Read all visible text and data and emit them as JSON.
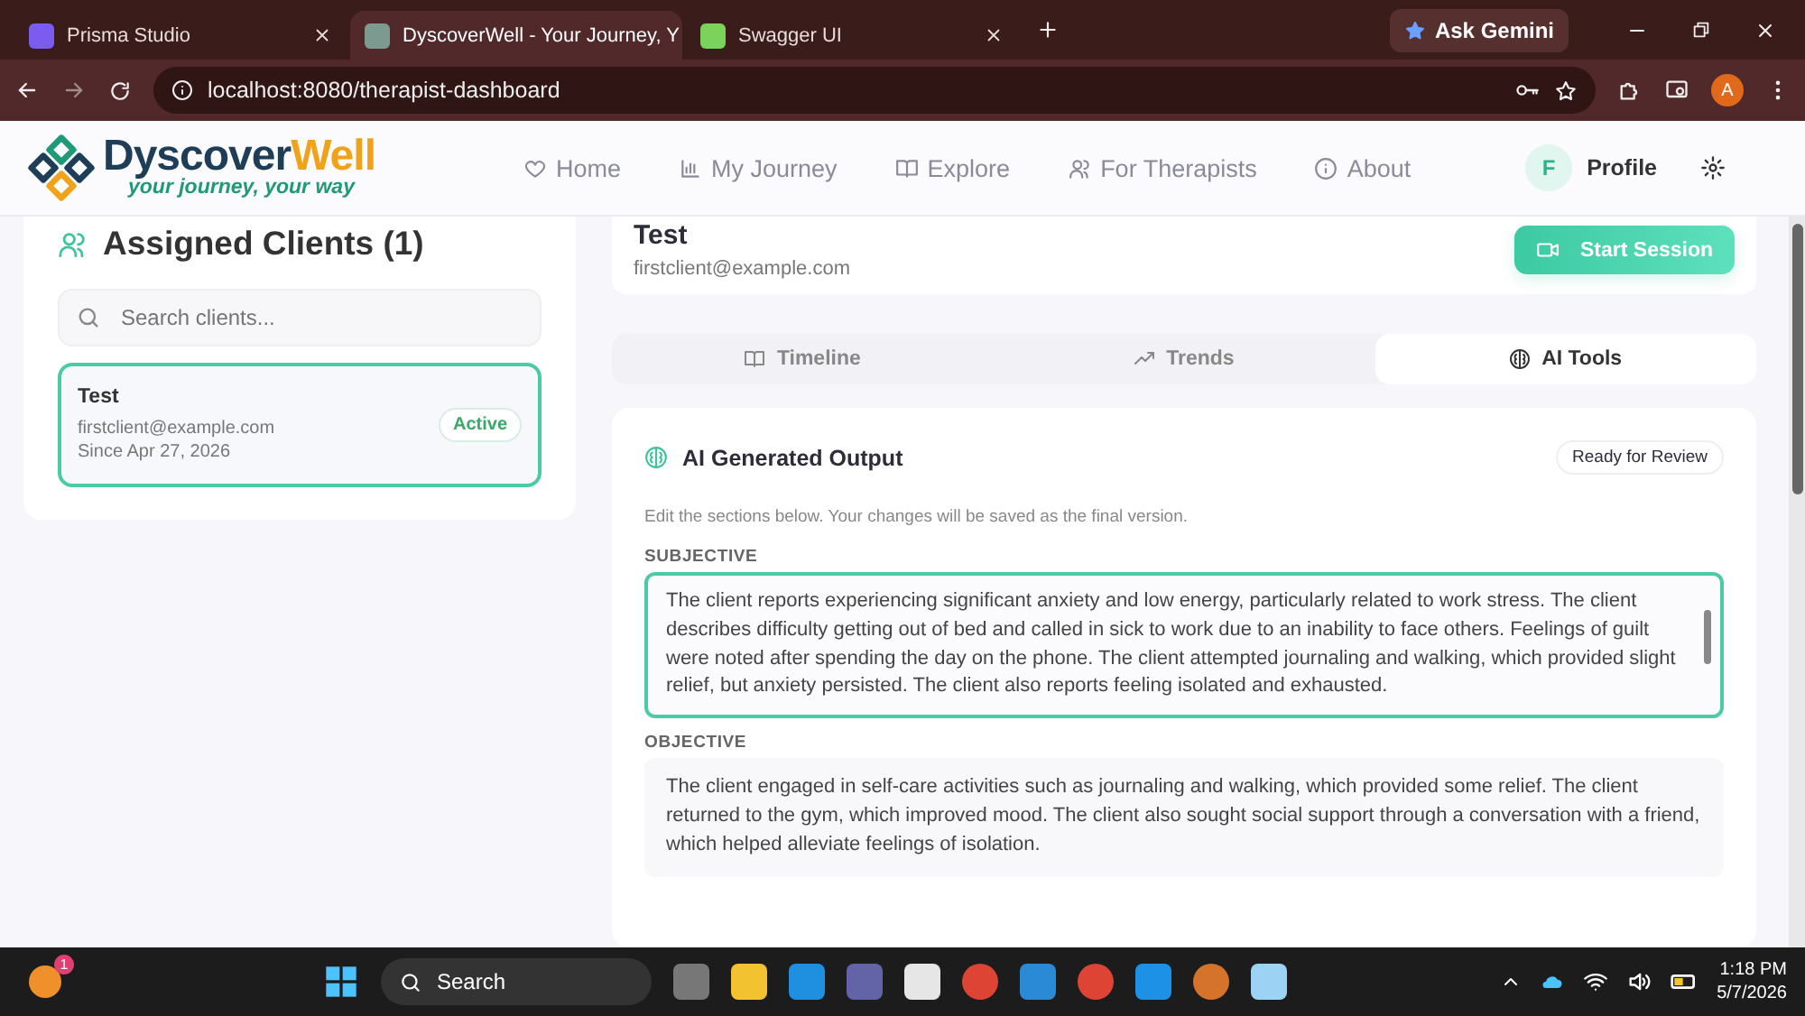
{
  "browser": {
    "tabs": [
      {
        "title": "Prisma Studio",
        "selected": false
      },
      {
        "title": "DyscoverWell - Your Journey, Y",
        "selected": true
      },
      {
        "title": "Swagger UI",
        "selected": false
      }
    ],
    "gemini": "Ask Gemini",
    "url": "localhost:8080/therapist-dashboard",
    "avatar": "A"
  },
  "header": {
    "logo": "Dyscover",
    "logo_accent": "Well",
    "tagline": "your journey, your way",
    "nav": [
      {
        "label": "Home"
      },
      {
        "label": "My Journey"
      },
      {
        "label": "Explore"
      },
      {
        "label": "For Therapists"
      },
      {
        "label": "About"
      }
    ],
    "profile_initial": "F",
    "profile": "Profile"
  },
  "clients": {
    "title": "Assigned Clients (1)",
    "search_placeholder": "Search clients...",
    "items": [
      {
        "name": "Test",
        "email": "firstclient@example.com",
        "since": "Since Apr 27, 2026",
        "status": "Active",
        "selected": true
      }
    ]
  },
  "client": {
    "name": "Test",
    "email": "firstclient@example.com",
    "start": "Start Session"
  },
  "tabs": [
    {
      "label": "Timeline",
      "selected": false
    },
    {
      "label": "Trends",
      "selected": false
    },
    {
      "label": "AI Tools",
      "selected": true
    }
  ],
  "output": {
    "title": "AI Generated Output",
    "badge": "Ready for Review",
    "hint": "Edit the sections below. Your changes will be saved as the final version.",
    "sections": [
      {
        "label": "SUBJECTIVE",
        "focused": true,
        "text": "The client reports experiencing significant anxiety and low energy, particularly related to work stress. The client describes difficulty getting out of bed and called in sick to work due to an inability to face others. Feelings of guilt were noted after spending the day on the phone. The client attempted journaling and walking, which provided slight relief, but anxiety persisted. The client also reports feeling isolated and exhausted."
      },
      {
        "label": "OBJECTIVE",
        "focused": false,
        "text": "The client engaged in self-care activities such as journaling and walking, which provided some relief. The client returned to the gym, which improved mood. The client also sought social support through a conversation with a friend, which helped alleviate feelings of isolation."
      }
    ]
  },
  "taskbar": {
    "notification": "1",
    "search": "Search",
    "time": "1:18 PM",
    "date": "5/7/2026"
  }
}
